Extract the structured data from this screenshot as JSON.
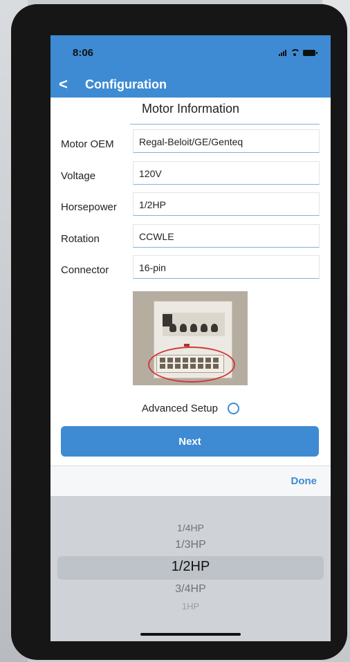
{
  "status_bar": {
    "time": "8:06"
  },
  "nav": {
    "back_symbol": "<",
    "title": "Configuration"
  },
  "section": {
    "title": "Motor Information"
  },
  "fields": [
    {
      "label": "Motor OEM",
      "value": "Regal-Beloit/GE/Genteq"
    },
    {
      "label": "Voltage",
      "value": "120V"
    },
    {
      "label": "Horsepower",
      "value": "1/2HP"
    },
    {
      "label": "Rotation",
      "value": "CCWLE"
    },
    {
      "label": "Connector",
      "value": "16-pin"
    }
  ],
  "advanced": {
    "label": "Advanced Setup",
    "selected": false
  },
  "next_button": {
    "label": "Next"
  },
  "picker_toolbar": {
    "done_label": "Done"
  },
  "picker": {
    "options": [
      "1/4HP",
      "1/3HP",
      "1/2HP",
      "3/4HP",
      "1HP"
    ],
    "selected": "1/2HP"
  },
  "colors": {
    "accent": "#3e8bd3",
    "picker_bg": "#cfd3d8"
  }
}
